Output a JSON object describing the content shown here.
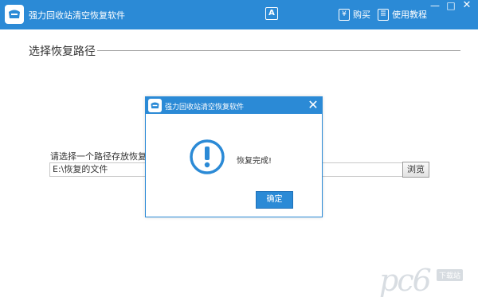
{
  "app": {
    "title": "强力回收站清空恢复软件",
    "icon": "recycle-bin-logo-icon",
    "accent_color": "#2b8ad6"
  },
  "toolbar": {
    "a_icon": "A",
    "buy_icon": "¥",
    "buy_label": "购买",
    "tutorial_icon": "book-icon",
    "tutorial_label": "使用教程"
  },
  "window_buttons": {
    "minimize": "—",
    "maximize": "□",
    "close": "✕"
  },
  "main": {
    "section_title": "选择恢复路径",
    "path_label": "请选择一个路径存放恢复出的文",
    "path_value": "E:\\恢复的文件",
    "browse_label": "浏览"
  },
  "dialog": {
    "title": "强力回收站清空恢复软件",
    "close": "✕",
    "message": "恢复完成!",
    "icon": "exclamation-circle-icon",
    "ok_label": "确定"
  },
  "watermark": {
    "logo": "pc6",
    "tag": "下载站"
  }
}
